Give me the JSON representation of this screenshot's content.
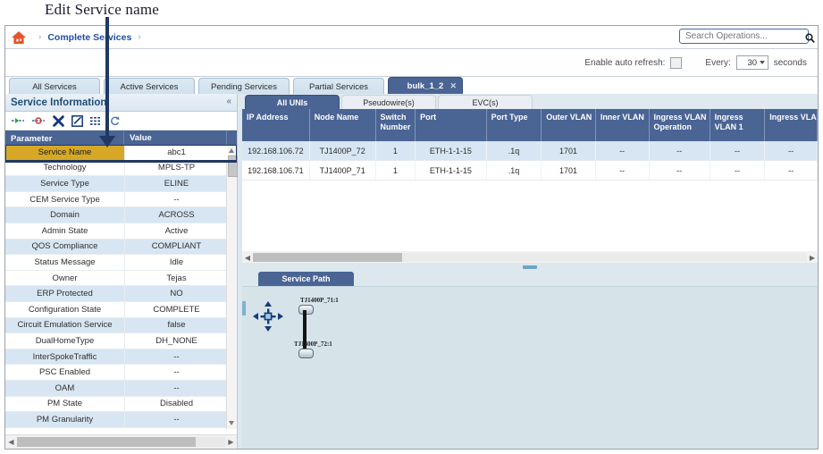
{
  "annotation": {
    "text": "Edit Service name"
  },
  "breadcrumb": {
    "home_title": "Home",
    "items": [
      {
        "label": "Complete Services"
      }
    ]
  },
  "search": {
    "placeholder": "Search Operations...",
    "value": "",
    "icon": "search-icon"
  },
  "auto_refresh": {
    "label": "Enable auto refresh:",
    "checked": false,
    "every_label": "Every:",
    "interval": "30",
    "seconds_label": "seconds"
  },
  "main_tabs": [
    {
      "label": "All Services",
      "active": false
    },
    {
      "label": "Active Services",
      "active": false
    },
    {
      "label": "Pending Services",
      "active": false
    },
    {
      "label": "Partial Services",
      "active": false
    },
    {
      "label": "bulk_1_2",
      "active": true,
      "closable": true
    }
  ],
  "left_panel": {
    "title": "Service Information",
    "collapse_icon": "double-chevron-left-icon",
    "toolbar": [
      {
        "name": "add-link-icon"
      },
      {
        "name": "remove-link-icon"
      },
      {
        "name": "delete-icon"
      },
      {
        "name": "edit-icon"
      },
      {
        "name": "details-icon"
      },
      {
        "name": "refresh-icon"
      }
    ],
    "columns": [
      "Parameter",
      "Value"
    ],
    "rows": [
      {
        "parameter": "Service Name",
        "value": "abc1",
        "selected": true
      },
      {
        "parameter": "Technology",
        "value": "MPLS-TP"
      },
      {
        "parameter": "Service Type",
        "value": "ELINE"
      },
      {
        "parameter": "CEM Service Type",
        "value": "--"
      },
      {
        "parameter": "Domain",
        "value": "ACROSS"
      },
      {
        "parameter": "Admin State",
        "value": "Active"
      },
      {
        "parameter": "QOS Compliance",
        "value": "COMPLIANT"
      },
      {
        "parameter": "Status Message",
        "value": "Idle"
      },
      {
        "parameter": "Owner",
        "value": "Tejas"
      },
      {
        "parameter": "ERP Protected",
        "value": "NO"
      },
      {
        "parameter": "Configuration State",
        "value": "COMPLETE"
      },
      {
        "parameter": "Circuit Emulation Service",
        "value": "false"
      },
      {
        "parameter": "DualHomeType",
        "value": "DH_NONE"
      },
      {
        "parameter": "InterSpokeTraffic",
        "value": "--"
      },
      {
        "parameter": "PSC Enabled",
        "value": "--"
      },
      {
        "parameter": "OAM",
        "value": "--"
      },
      {
        "parameter": "PM State",
        "value": "Disabled"
      },
      {
        "parameter": "PM Granularity",
        "value": "--"
      }
    ]
  },
  "right_panel": {
    "sub_tabs": [
      {
        "label": "All UNIs",
        "active": true
      },
      {
        "label": "Pseudowire(s)",
        "active": false
      },
      {
        "label": "EVC(s)",
        "active": false
      }
    ],
    "uni_grid": {
      "columns": [
        "IP Address",
        "Node Name",
        "Switch Number",
        "Port",
        "Port Type",
        "Outer VLAN",
        "Inner VLAN",
        "Ingress VLAN Operation",
        "Ingress VLAN 1",
        "Ingress VLA"
      ],
      "rows": [
        [
          "192.168.106.72",
          "TJ1400P_72",
          "1",
          "ETH-1-1-15",
          ".1q",
          "1701",
          "--",
          "--",
          "--",
          "--"
        ],
        [
          "192.168.106.71",
          "TJ1400P_71",
          "1",
          "ETH-1-1-15",
          ".1q",
          "1701",
          "--",
          "--",
          "--",
          "--"
        ]
      ]
    },
    "service_path": {
      "tab_label": "Service Path",
      "nodes": [
        {
          "label": "TJ1400P_71:1"
        },
        {
          "label": "TJ1400P_72:1"
        }
      ]
    }
  }
}
